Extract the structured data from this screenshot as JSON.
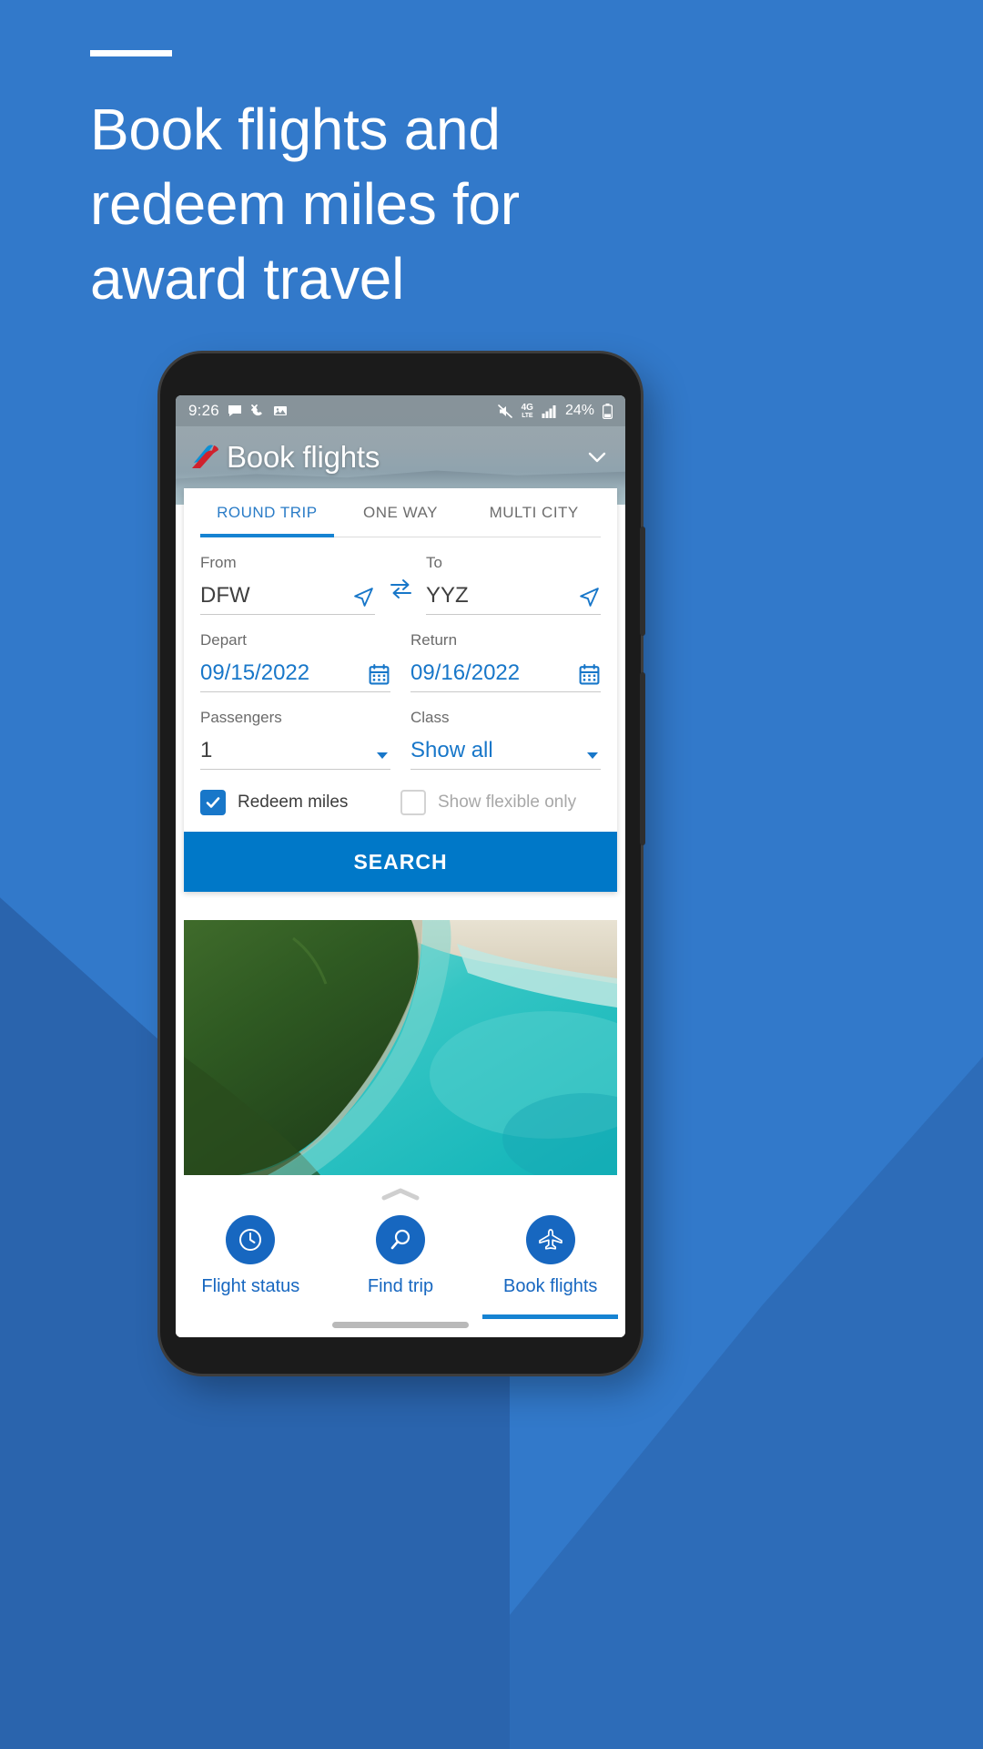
{
  "promo": {
    "headline": "Book flights and redeem miles for award travel",
    "background_color": "#3279ca",
    "accent_color": "#2a64ad"
  },
  "status_bar": {
    "time": "9:26",
    "left_icons": [
      "message-icon",
      "missed-call-icon",
      "photo-icon"
    ],
    "mute_icon": "mute-icon",
    "network": "4G",
    "network_sub": "LTE",
    "signal_icon": "signal-bars-icon",
    "battery_text": "24%",
    "battery_icon": "battery-icon"
  },
  "header": {
    "logo": "american-airlines-logo",
    "title": "Book flights",
    "chevron": "chevron-down-icon"
  },
  "search_form": {
    "tabs": [
      {
        "label": "ROUND TRIP",
        "active": true
      },
      {
        "label": "ONE WAY",
        "active": false
      },
      {
        "label": "MULTI CITY",
        "active": false
      }
    ],
    "from": {
      "label": "From",
      "value": "DFW",
      "icon": "location-arrow-icon"
    },
    "to": {
      "label": "To",
      "value": "YYZ",
      "icon": "location-arrow-icon"
    },
    "swap_icon": "swap-arrows-icon",
    "depart": {
      "label": "Depart",
      "value": "09/15/2022",
      "icon": "calendar-icon"
    },
    "return": {
      "label": "Return",
      "value": "09/16/2022",
      "icon": "calendar-icon"
    },
    "passengers": {
      "label": "Passengers",
      "value": "1",
      "icon": "chevron-down-icon"
    },
    "travel_class": {
      "label": "Class",
      "value": "Show all",
      "icon": "chevron-down-icon"
    },
    "redeem_miles": {
      "label": "Redeem miles",
      "checked": true
    },
    "show_flexible_only": {
      "label": "Show flexible only",
      "checked": false
    },
    "search_button": "SEARCH",
    "primary_color": "#0078c8",
    "link_color": "#1877c9"
  },
  "bottom_nav": {
    "handle_icon": "chevron-up-icon",
    "items": [
      {
        "label": "Flight status",
        "icon": "clock-icon",
        "active": false
      },
      {
        "label": "Find trip",
        "icon": "search-icon",
        "active": false
      },
      {
        "label": "Book flights",
        "icon": "airplane-icon",
        "active": true
      }
    ]
  }
}
